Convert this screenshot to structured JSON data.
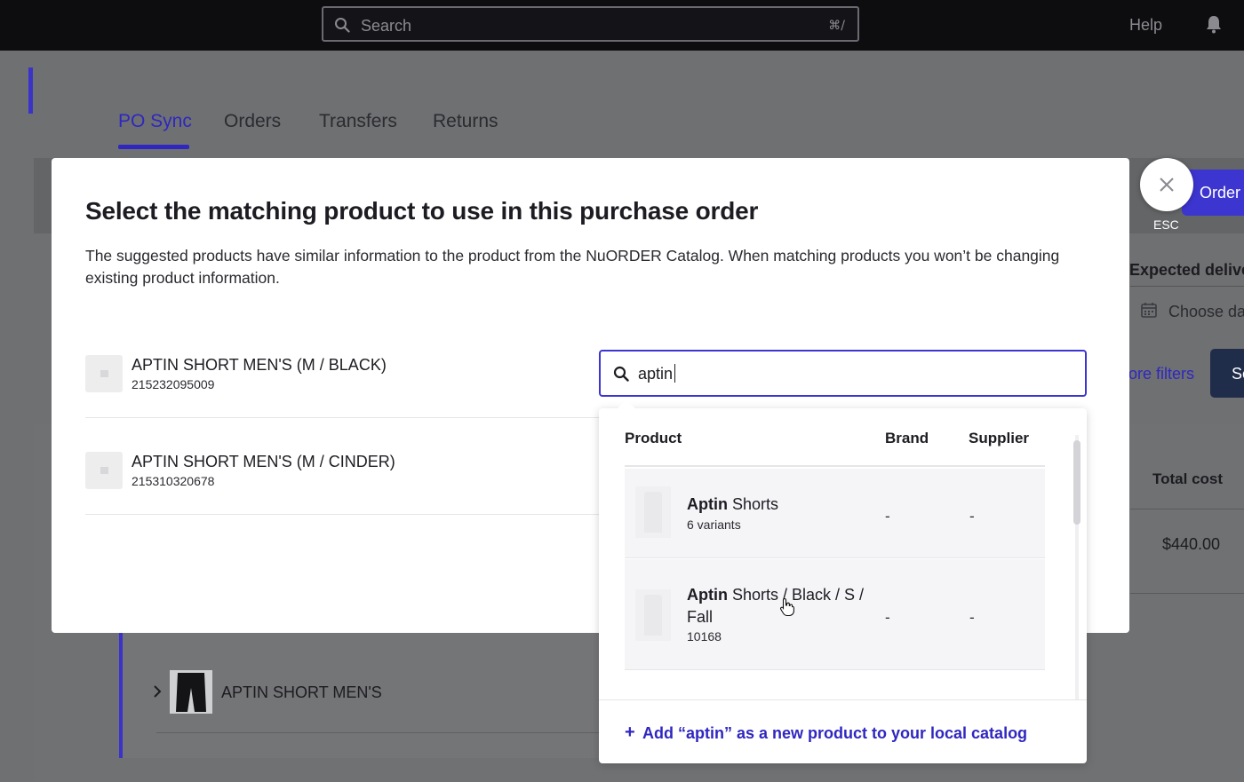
{
  "topbar": {
    "search_placeholder": "Search",
    "search_shortcut": "⌘/",
    "help_label": "Help",
    "icons": [
      "search-icon",
      "bell-icon"
    ]
  },
  "tabs": [
    {
      "label": "PO Sync",
      "active": true
    },
    {
      "label": "Orders",
      "active": false
    },
    {
      "label": "Transfers",
      "active": false
    },
    {
      "label": "Returns",
      "active": false
    }
  ],
  "background": {
    "order_button_label": "Order",
    "esc_label": "ESC",
    "expected_delivery_label": "Expected delive",
    "choose_date_label": "Choose da",
    "more_filters_label": "ore filters",
    "dark_button_label": "Se",
    "total_cost_header": "Total cost",
    "total_cost_value": "$440.00",
    "product_name": "APTIN SHORT MEN'S"
  },
  "modal": {
    "title": "Select the matching product to use in this purchase order",
    "description": "The suggested products have similar information to the product from the NuORDER Catalog. When matching products you won’t be changing existing product information.",
    "rows": [
      {
        "name": "APTIN SHORT MEN'S (M / BLACK)",
        "sku": "215232095009"
      },
      {
        "name": "APTIN SHORT MEN'S (M / CINDER)",
        "sku": "215310320678"
      }
    ],
    "search_value": "aptin",
    "dropdown": {
      "headers": {
        "product": "Product",
        "brand": "Brand",
        "supplier": "Supplier"
      },
      "items": [
        {
          "match": "Aptin",
          "rest": " Shorts",
          "sub": "6 variants",
          "brand": "-",
          "supplier": "-"
        },
        {
          "match": "Aptin",
          "rest": " Shorts / Black / S / Fall",
          "sub": "10168",
          "brand": "-",
          "supplier": "-"
        }
      ],
      "add_label": "Add “aptin” as a new product to your local catalog",
      "add_icon": "plus-icon"
    }
  },
  "colors": {
    "accent": "#2f27c0",
    "topbar": "#0d0d10",
    "overlay": "#6f7072"
  }
}
